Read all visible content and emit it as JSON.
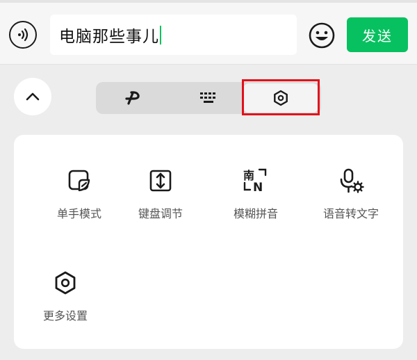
{
  "input": {
    "text": "电脑那些事儿",
    "send_label": "发送"
  },
  "tabs": [
    {
      "id": "handwriting",
      "icon": "handwriting-icon"
    },
    {
      "id": "keyboard",
      "icon": "keyboard-icon"
    },
    {
      "id": "settings",
      "icon": "settings-hexagon-icon",
      "selected": true
    }
  ],
  "tools": [
    {
      "label": "单手模式",
      "icon": "one-hand-mode-icon"
    },
    {
      "label": "键盘调节",
      "icon": "keyboard-adjust-icon"
    },
    {
      "label": "模糊拼音",
      "icon": "fuzzy-pinyin-icon"
    },
    {
      "label": "语音转文字",
      "icon": "voice-to-text-icon"
    },
    {
      "label": "更多设置",
      "icon": "more-settings-icon"
    }
  ],
  "colors": {
    "accent": "#07c160",
    "highlight": "#e3101a"
  }
}
